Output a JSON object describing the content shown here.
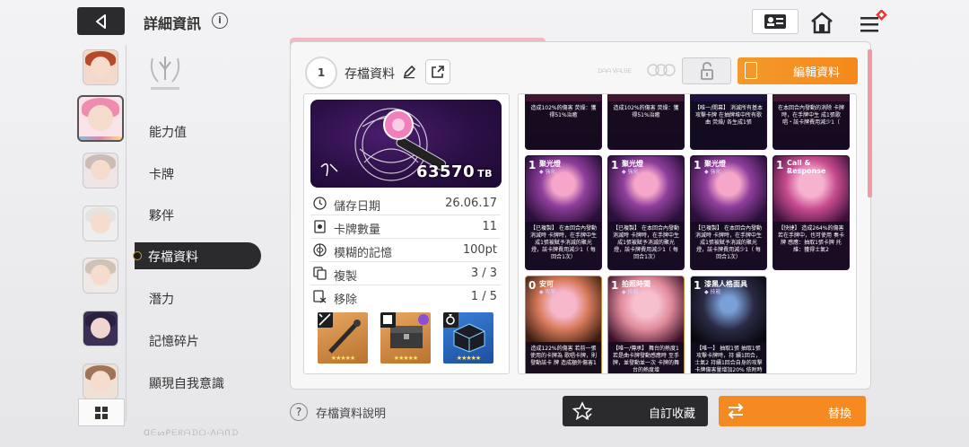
{
  "header": {
    "title": "詳細資訊",
    "info_icon": "i"
  },
  "sidebar": {
    "menu": [
      {
        "label": "能力值"
      },
      {
        "label": "卡牌"
      },
      {
        "label": "夥伴"
      },
      {
        "label": "存檔資料",
        "active": true
      },
      {
        "label": "潛力"
      },
      {
        "label": "記憶碎片"
      },
      {
        "label": "顯現自我意識"
      }
    ]
  },
  "savedata": {
    "slot_number": "1",
    "title": "存檔資料",
    "tb_value": "63570",
    "tb_unit": "TB",
    "edit_label": "編輯資料",
    "stats": [
      {
        "icon": "clock-icon",
        "label": "儲存日期",
        "value": "26.06.17"
      },
      {
        "icon": "card-icon",
        "label": "卡牌數量",
        "value": "11"
      },
      {
        "icon": "memory-icon",
        "label": "模糊的記憶",
        "value": "100pt"
      },
      {
        "icon": "copy-icon",
        "label": "複製",
        "value": "3 / 3"
      },
      {
        "icon": "remove-icon",
        "label": "移除",
        "value": "1 / 5"
      }
    ],
    "equipment_stars": "★★★★★"
  },
  "cards": {
    "top_row": [
      {
        "text": "造成102%的傷害 荧燥：獲得51%治癒"
      },
      {
        "text": "造成102%的傷害 荧燥：獲得51%治癒"
      },
      {
        "text": "【唯一/開幕】 消滅所有基本攻擊卡牌 在抽牌堆中所有歌曲 荧燥/ 各生成1張"
      },
      {
        "text": "在本回合內發動的消除 卡牌時，在手牌中生 成1張歌唱・該卡牌費用減少1（"
      }
    ],
    "mid_row": [
      {
        "cost": "1",
        "name": "聚光燈",
        "sub": "◆ 強化",
        "text": "【已複製】 在本回合內發動消滅時 卡牌時，在手牌中生 成1張被賦予消滅的聚光 燈，該卡牌費用減少1（ 每回合1次）"
      },
      {
        "cost": "1",
        "name": "聚光燈",
        "sub": "◆ 強化",
        "text": "【已複製】 在本回合內發動消滅時 卡牌時，在手牌中生 成1張被賦予消滅的聚光 燈，該卡牌費用減少1（ 每回合1次）"
      },
      {
        "cost": "1",
        "name": "聚光燈",
        "sub": "◆ 強化",
        "text": "【已複製】 在本回合內發動消滅時 卡牌時，在手牌中生 成1張被賦予消滅的聚光 燈，該卡牌費用減少1（ 每回合1次）"
      },
      {
        "cost": "1",
        "name": "Call & Response",
        "sub": "◆ 攻擊",
        "text": "【快捷】 造成264%的傷害 若在手牌中，也可使用 奏卡牌 感應：抽取1張卡牌 托維：獲得士氣2"
      }
    ],
    "bot_row": [
      {
        "cost": "0",
        "name": "安可",
        "sub": "◆ 攻擊",
        "text": "造成122%的傷害 若前一張使用的卡牌為 歌唱卡牌，則發動該卡 牌 造成額外傷害1"
      },
      {
        "cost": "1",
        "name": "拍照時間",
        "sub": "◆ 技能",
        "text": "【唯一/傳承】 舞台的熱度1 若是曲卡牌發動感應時 至手牌，並發動並一次 卡牌的舞台的熱度增"
      },
      {
        "cost": "1",
        "name": "漆黑人格面具",
        "sub": "◆ 技能",
        "text": "【唯一】 抽取1張 抽取1張攻擊卡牌時，持 續1回合，士氣2 持續1回合自身的攻擊 卡牌傷害量增加20% 依附時則抽取數量"
      }
    ]
  },
  "footer": {
    "help_icon": "?",
    "help_label": "存檔資料說明",
    "favorite_label": "自訂收藏",
    "swap_label": "替換"
  },
  "colors": {
    "accent_orange": "#f58a22",
    "dark": "#2b2b2d",
    "pink": "#ef9aa5"
  }
}
